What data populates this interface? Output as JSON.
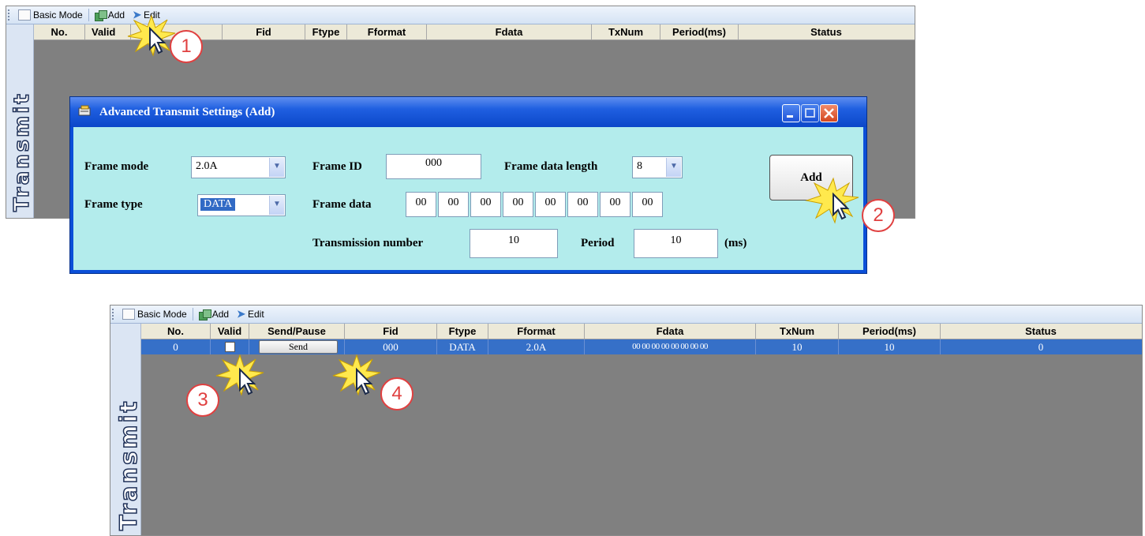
{
  "toolbar": {
    "basic_mode": "Basic Mode",
    "add": "Add",
    "edit": "Edit"
  },
  "side_label": "Transmit",
  "grid_headers": [
    "No.",
    "Valid",
    "Send/Pause",
    "Fid",
    "Ftype",
    "Fformat",
    "Fdata",
    "TxNum",
    "Period(ms)",
    "Status"
  ],
  "top_panel_visible_headers": {
    "no": "No.",
    "valid": "Valid",
    "fid": "Fid",
    "ftype": "Ftype",
    "fformat": "Fformat",
    "fdata": "Fdata",
    "txnum": "TxNum",
    "period": "Period(ms)",
    "status": "Status"
  },
  "dialog": {
    "title": "Advanced Transmit Settings (Add)",
    "frame_mode_label": "Frame mode",
    "frame_mode_value": "2.0A",
    "frame_type_label": "Frame type",
    "frame_type_value": "DATA",
    "frame_id_label": "Frame ID",
    "frame_id_value": "000",
    "frame_data_length_label": "Frame data length",
    "frame_data_length_value": "8",
    "frame_data_label": "Frame data",
    "frame_data_bytes": [
      "00",
      "00",
      "00",
      "00",
      "00",
      "00",
      "00",
      "00"
    ],
    "transmission_number_label": "Transmission number",
    "transmission_number_value": "10",
    "period_label": "Period",
    "period_value": "10",
    "period_unit": "(ms)",
    "add_button": "Add"
  },
  "result_row": {
    "no": "0",
    "send_label": "Send",
    "fid": "000",
    "ftype": "DATA",
    "fformat": "2.0A",
    "fdata": "00 00 00 00 00 00 00 00",
    "txnum": "10",
    "period": "10",
    "status": "0"
  },
  "callouts": [
    "1",
    "2",
    "3",
    "4"
  ],
  "colors": {
    "selected_row": "#3670c8",
    "dialog_client": "#b3ecec",
    "callout": "#e04040",
    "burst": "#ffe94d"
  }
}
